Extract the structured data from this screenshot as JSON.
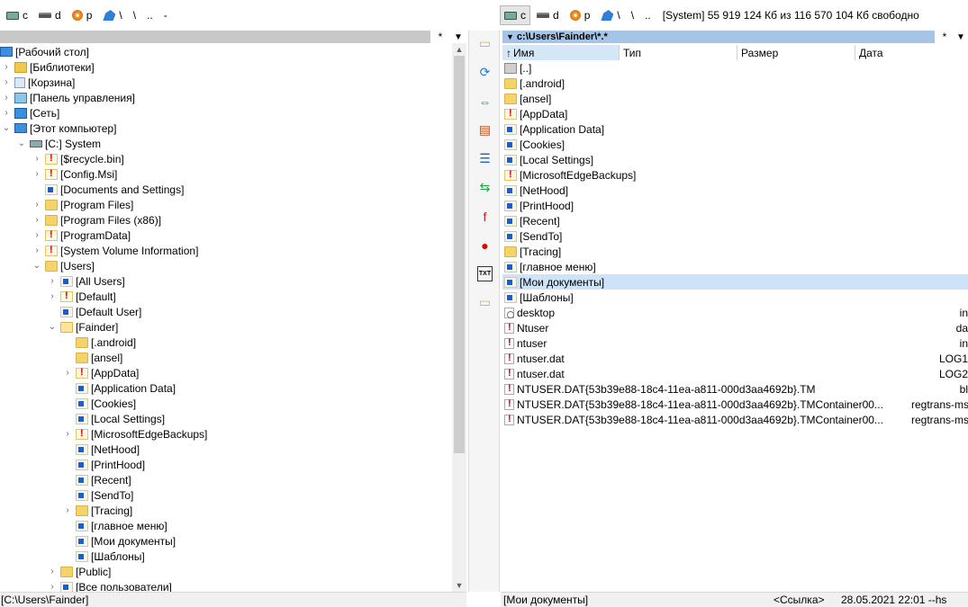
{
  "left_drives": {
    "items": [
      {
        "label": "c",
        "icon": "system-drive-icon",
        "active": false
      },
      {
        "label": "d",
        "icon": "hard-drive-icon",
        "active": false
      },
      {
        "label": "p",
        "icon": "cd-drive-icon",
        "active": false
      },
      {
        "label": "\\",
        "icon": "network-icon",
        "active": false
      },
      {
        "label": "\\",
        "icon": "",
        "active": false
      },
      {
        "label": "..",
        "icon": "",
        "active": false
      },
      {
        "label": "-",
        "icon": "",
        "active": false
      }
    ]
  },
  "right_drives": {
    "items": [
      {
        "label": "c",
        "icon": "system-drive-icon",
        "active": true
      },
      {
        "label": "d",
        "icon": "hard-drive-icon",
        "active": false
      },
      {
        "label": "p",
        "icon": "cd-drive-icon",
        "active": false
      },
      {
        "label": "\\",
        "icon": "network-icon",
        "active": false
      },
      {
        "label": "\\",
        "icon": "",
        "active": false
      },
      {
        "label": "..",
        "icon": "",
        "active": false
      }
    ],
    "free_space": "[System]  55 919 124 Кб из 116 570 104 Кб свободно"
  },
  "left_panel": {
    "filter_star": "*",
    "dropdown": "▼",
    "tree": [
      {
        "indent": 0,
        "toggle": "",
        "icon": "monitor",
        "label": "[Рабочий стол]"
      },
      {
        "indent": 1,
        "toggle": ">",
        "icon": "lib",
        "label": "[Библиотеки]"
      },
      {
        "indent": 1,
        "toggle": ">",
        "icon": "trash",
        "label": "[Корзина]"
      },
      {
        "indent": 1,
        "toggle": ">",
        "icon": "panel",
        "label": "[Панель управления]"
      },
      {
        "indent": 1,
        "toggle": ">",
        "icon": "network",
        "label": "[Сеть]"
      },
      {
        "indent": 1,
        "toggle": "v",
        "icon": "monitor",
        "label": "[Этот компьютер]"
      },
      {
        "indent": 2,
        "toggle": "v",
        "icon": "drive",
        "label": "[C:]  System"
      },
      {
        "indent": 3,
        "toggle": ">",
        "icon": "lock",
        "label": "[$recycle.bin]"
      },
      {
        "indent": 3,
        "toggle": ">",
        "icon": "lock",
        "label": "[Config.Msi]"
      },
      {
        "indent": 3,
        "toggle": "",
        "icon": "link",
        "label": "[Documents and Settings]"
      },
      {
        "indent": 3,
        "toggle": ">",
        "icon": "folder",
        "label": "[Program Files]"
      },
      {
        "indent": 3,
        "toggle": ">",
        "icon": "folder",
        "label": "[Program Files (x86)]"
      },
      {
        "indent": 3,
        "toggle": ">",
        "icon": "lock",
        "label": "[ProgramData]"
      },
      {
        "indent": 3,
        "toggle": ">",
        "icon": "lock",
        "label": "[System Volume Information]"
      },
      {
        "indent": 3,
        "toggle": "v",
        "icon": "folder",
        "label": "[Users]"
      },
      {
        "indent": 4,
        "toggle": ">",
        "icon": "link",
        "label": "[All Users]"
      },
      {
        "indent": 4,
        "toggle": ">",
        "icon": "lock",
        "label": "[Default]"
      },
      {
        "indent": 4,
        "toggle": "",
        "icon": "link",
        "label": "[Default User]"
      },
      {
        "indent": 4,
        "toggle": "v",
        "icon": "folder open",
        "label": "[Fainder]"
      },
      {
        "indent": 5,
        "toggle": "",
        "icon": "folder",
        "label": "[.android]"
      },
      {
        "indent": 5,
        "toggle": "",
        "icon": "folder",
        "label": "[ansel]"
      },
      {
        "indent": 5,
        "toggle": ">",
        "icon": "lock",
        "label": "[AppData]"
      },
      {
        "indent": 5,
        "toggle": "",
        "icon": "link",
        "label": "[Application Data]"
      },
      {
        "indent": 5,
        "toggle": "",
        "icon": "link",
        "label": "[Cookies]"
      },
      {
        "indent": 5,
        "toggle": "",
        "icon": "link",
        "label": "[Local Settings]"
      },
      {
        "indent": 5,
        "toggle": ">",
        "icon": "lock",
        "label": "[MicrosoftEdgeBackups]"
      },
      {
        "indent": 5,
        "toggle": "",
        "icon": "link",
        "label": "[NetHood]"
      },
      {
        "indent": 5,
        "toggle": "",
        "icon": "link",
        "label": "[PrintHood]"
      },
      {
        "indent": 5,
        "toggle": "",
        "icon": "link",
        "label": "[Recent]"
      },
      {
        "indent": 5,
        "toggle": "",
        "icon": "link",
        "label": "[SendTo]"
      },
      {
        "indent": 5,
        "toggle": ">",
        "icon": "folder",
        "label": "[Tracing]"
      },
      {
        "indent": 5,
        "toggle": "",
        "icon": "link",
        "label": "[главное меню]"
      },
      {
        "indent": 5,
        "toggle": "",
        "icon": "link",
        "label": "[Мои документы]"
      },
      {
        "indent": 5,
        "toggle": "",
        "icon": "link",
        "label": "[Шаблоны]"
      },
      {
        "indent": 4,
        "toggle": ">",
        "icon": "folder",
        "label": "[Public]"
      },
      {
        "indent": 4,
        "toggle": ">",
        "icon": "link",
        "label": "[Все пользователи]"
      }
    ],
    "status": "[C:\\Users\\Fainder]"
  },
  "right_panel": {
    "path": "c:\\Users\\Fainder\\*.*",
    "filter_star": "*",
    "dropdown": "▼",
    "columns": [
      "Имя",
      "Тип",
      "Размер",
      "Дата"
    ],
    "sort_arrow": "↑",
    "files": [
      {
        "icon": "up",
        "name": "[..]",
        "ext": ""
      },
      {
        "icon": "folder",
        "name": "[.android]",
        "ext": ""
      },
      {
        "icon": "folder",
        "name": "[ansel]",
        "ext": ""
      },
      {
        "icon": "lock",
        "name": "[AppData]",
        "ext": ""
      },
      {
        "icon": "link",
        "name": "[Application Data]",
        "ext": ""
      },
      {
        "icon": "link",
        "name": "[Cookies]",
        "ext": ""
      },
      {
        "icon": "link",
        "name": "[Local Settings]",
        "ext": ""
      },
      {
        "icon": "lock",
        "name": "[MicrosoftEdgeBackups]",
        "ext": ""
      },
      {
        "icon": "link",
        "name": "[NetHood]",
        "ext": ""
      },
      {
        "icon": "link",
        "name": "[PrintHood]",
        "ext": ""
      },
      {
        "icon": "link",
        "name": "[Recent]",
        "ext": ""
      },
      {
        "icon": "link",
        "name": "[SendTo]",
        "ext": ""
      },
      {
        "icon": "folder",
        "name": "[Tracing]",
        "ext": ""
      },
      {
        "icon": "link",
        "name": "[главное меню]",
        "ext": ""
      },
      {
        "icon": "link",
        "name": "[Мои документы]",
        "ext": "",
        "selected": true
      },
      {
        "icon": "link",
        "name": "[Шаблоны]",
        "ext": ""
      },
      {
        "icon": "file gear",
        "name": "desktop",
        "ext": "in"
      },
      {
        "icon": "file warn",
        "name": "Ntuser",
        "ext": "da"
      },
      {
        "icon": "file warn",
        "name": "ntuser",
        "ext": "in"
      },
      {
        "icon": "file warn",
        "name": "ntuser.dat",
        "ext": "LOG1"
      },
      {
        "icon": "file warn",
        "name": "ntuser.dat",
        "ext": "LOG2"
      },
      {
        "icon": "file warn",
        "name": "NTUSER.DAT{53b39e88-18c4-11ea-a811-000d3aa4692b}.TM",
        "ext": "bl"
      },
      {
        "icon": "file warn",
        "name": "NTUSER.DAT{53b39e88-18c4-11ea-a811-000d3aa4692b}.TMContainer00...",
        "ext": "regtrans-ms"
      },
      {
        "icon": "file warn",
        "name": "NTUSER.DAT{53b39e88-18c4-11ea-a811-000d3aa4692b}.TMContainer00...",
        "ext": "regtrans-ms"
      }
    ],
    "status_name": "[Мои документы]",
    "status_type": "<Ссылка>",
    "status_date": "28.05.2021 22:01 --hs"
  },
  "midbar": {
    "buttons": [
      {
        "name": "folder-icon",
        "glyph": "▭",
        "color": "#e0b040"
      },
      {
        "name": "refresh-icon",
        "glyph": "⟳",
        "color": "#1a7fd6"
      },
      {
        "name": "compare-icon",
        "glyph": "⇔",
        "color": "#1ca04a"
      },
      {
        "name": "archive-icon",
        "glyph": "▤",
        "color": "#c05020"
      },
      {
        "name": "list-icon",
        "glyph": "☰",
        "color": "#2060c0"
      },
      {
        "name": "sync-icon",
        "glyph": "⇆",
        "color": "#20a040"
      },
      {
        "name": "font-icon",
        "glyph": "f",
        "color": "#c02020"
      },
      {
        "name": "record-icon",
        "glyph": "●",
        "color": "#e00000"
      },
      {
        "name": "txt-icon",
        "glyph": "TXT",
        "color": "#000000"
      },
      {
        "name": "open-folder-icon",
        "glyph": "▭",
        "color": "#e0b040"
      }
    ]
  }
}
